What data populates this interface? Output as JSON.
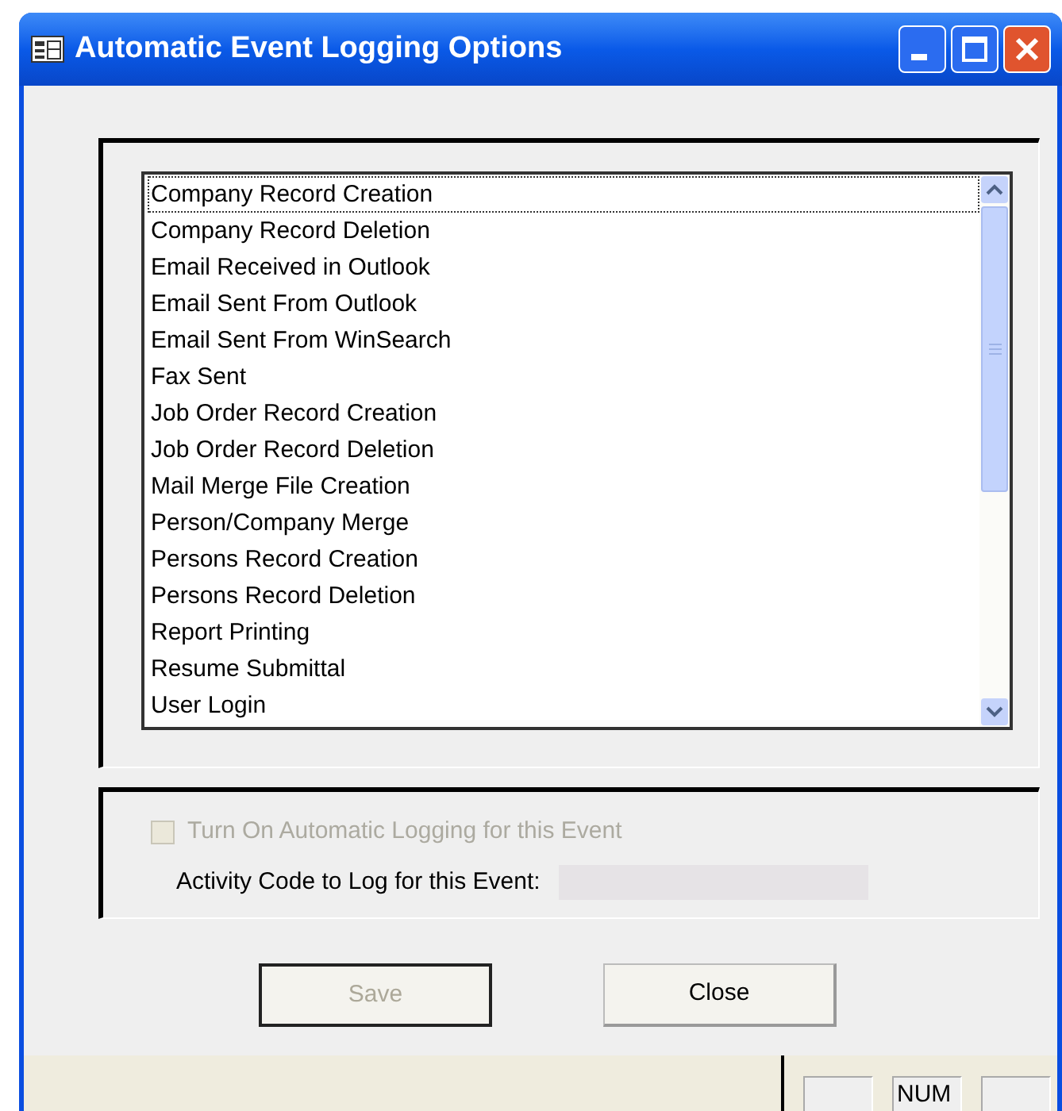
{
  "window": {
    "title": "Automatic Event Logging Options"
  },
  "events": [
    {
      "label": "Company Record Creation",
      "selected": true
    },
    {
      "label": "Company Record Deletion",
      "selected": false
    },
    {
      "label": "Email Received in Outlook",
      "selected": false
    },
    {
      "label": "Email Sent From Outlook",
      "selected": false
    },
    {
      "label": "Email Sent From WinSearch",
      "selected": false
    },
    {
      "label": "Fax Sent",
      "selected": false
    },
    {
      "label": "Job Order Record Creation",
      "selected": false
    },
    {
      "label": "Job Order Record Deletion",
      "selected": false
    },
    {
      "label": "Mail Merge File Creation",
      "selected": false
    },
    {
      "label": "Person/Company Merge",
      "selected": false
    },
    {
      "label": "Persons Record Creation",
      "selected": false
    },
    {
      "label": "Persons Record Deletion",
      "selected": false
    },
    {
      "label": "Report Printing",
      "selected": false
    },
    {
      "label": "Resume Submittal",
      "selected": false
    },
    {
      "label": "User Login",
      "selected": false
    }
  ],
  "logging_checkbox": {
    "label": "Turn On Automatic Logging for this Event",
    "checked": false,
    "disabled": true
  },
  "activity_code": {
    "label": "Activity Code to Log for this Event:",
    "disabled": true
  },
  "buttons": [
    {
      "label": "Save",
      "disabled": true
    },
    {
      "label": "Close",
      "disabled": false
    }
  ],
  "status_bar": {
    "num_indicator": "NUM"
  }
}
